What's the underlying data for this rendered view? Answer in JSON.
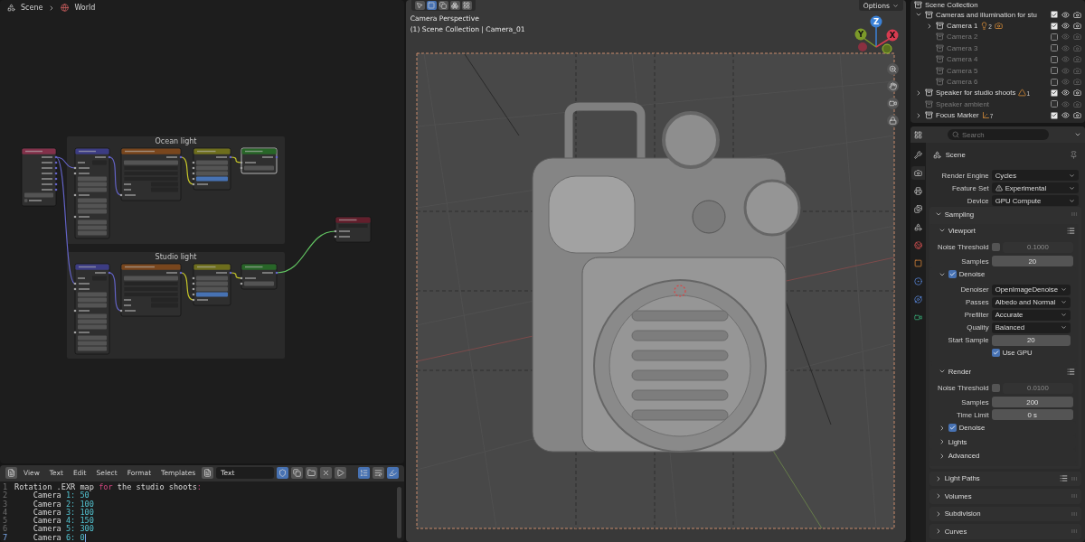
{
  "node_editor": {
    "breadcrumb": [
      "Scene",
      "World"
    ],
    "frames": [
      {
        "label": "Ocean light"
      },
      {
        "label": "Studio light"
      }
    ]
  },
  "text_editor": {
    "menus": [
      "View",
      "Text",
      "Edit",
      "Select",
      "Format",
      "Templates"
    ],
    "text_name": "Text",
    "fake_user": true,
    "toggles": [
      {
        "kind": "line_numbers",
        "on": true
      },
      {
        "kind": "word_wrap",
        "on": false
      },
      {
        "kind": "syntax",
        "on": true
      }
    ],
    "lines": [
      {
        "number": "1",
        "current": false,
        "segments": [
          {
            "kind": "plain",
            "text": "Rotation .EXR map "
          },
          {
            "kind": "keyword",
            "text": "for"
          },
          {
            "kind": "plain",
            "text": " the studio shoots"
          },
          {
            "kind": "keyword",
            "text": ":"
          }
        ]
      },
      {
        "number": "2",
        "current": false,
        "segments": [
          {
            "kind": "plain",
            "text": "    Camera "
          },
          {
            "kind": "number",
            "text": "1: 50"
          }
        ]
      },
      {
        "number": "3",
        "current": false,
        "segments": [
          {
            "kind": "plain",
            "text": "    Camera "
          },
          {
            "kind": "number",
            "text": "2: 100"
          }
        ]
      },
      {
        "number": "4",
        "current": false,
        "segments": [
          {
            "kind": "plain",
            "text": "    Camera "
          },
          {
            "kind": "number",
            "text": "3: 100"
          }
        ]
      },
      {
        "number": "5",
        "current": false,
        "segments": [
          {
            "kind": "plain",
            "text": "    Camera "
          },
          {
            "kind": "number",
            "text": "4: 150"
          }
        ]
      },
      {
        "number": "6",
        "current": false,
        "segments": [
          {
            "kind": "plain",
            "text": "    Camera "
          },
          {
            "kind": "number",
            "text": "5: 300"
          }
        ]
      },
      {
        "number": "7",
        "current": true,
        "segments": [
          {
            "kind": "plain",
            "text": "    Camera "
          },
          {
            "kind": "number",
            "text": "6: 0"
          }
        ]
      }
    ]
  },
  "viewport": {
    "options_label": "Options",
    "view_name": "Camera Perspective",
    "collection_info": "(1) Scene Collection | Camera_01",
    "axes": [
      "Z",
      "Y",
      "X"
    ]
  },
  "outliner": {
    "root": "Scene Collection",
    "items": [
      {
        "label": "Cameras and illumination for stu",
        "checked": true,
        "expanded": true,
        "children": [
          {
            "label": "Camera 1",
            "checked": true,
            "expanded": false,
            "badges": [
              {
                "kind": "light",
                "count": "2"
              },
              {
                "kind": "camera"
              }
            ]
          },
          {
            "label": "Camera 2",
            "checked": false
          },
          {
            "label": "Camera 3",
            "checked": false
          },
          {
            "label": "Camera 4",
            "checked": false
          },
          {
            "label": "Camera 5",
            "checked": false
          },
          {
            "label": "Camera 6",
            "checked": false
          }
        ]
      },
      {
        "label": "Speaker for studio shoots",
        "checked": true,
        "expanded": false,
        "badges": [
          {
            "kind": "speaker",
            "count": "1"
          }
        ]
      },
      {
        "label": "Speaker ambient",
        "checked": false
      },
      {
        "label": "Focus Marker",
        "checked": true,
        "expanded": false,
        "badges": [
          {
            "kind": "empty",
            "count": "7"
          }
        ]
      }
    ]
  },
  "properties": {
    "search_placeholder": "Search",
    "context": "Scene",
    "tabs": [
      {
        "kind": "tool",
        "selected": false
      },
      {
        "kind": "render",
        "selected": true
      },
      {
        "kind": "output",
        "selected": false
      },
      {
        "kind": "view_layer",
        "selected": false
      },
      {
        "kind": "scene",
        "selected": false
      },
      {
        "kind": "world",
        "selected": false
      },
      {
        "kind": "object",
        "selected": false
      },
      {
        "kind": "modifier",
        "selected": false
      },
      {
        "kind": "physics",
        "selected": false
      },
      {
        "kind": "data",
        "selected": false
      }
    ],
    "items": [
      {
        "kind": "dropdown",
        "label": "Render Engine",
        "value": "Cycles"
      },
      {
        "kind": "dropdown",
        "label": "Feature Set",
        "value": "Experimental",
        "warning": true
      },
      {
        "kind": "dropdown",
        "label": "Device",
        "value": "GPU Compute"
      },
      {
        "kind": "panel",
        "label": "Sampling",
        "expanded": true,
        "children": [
          {
            "kind": "subpanel",
            "label": "Viewport",
            "expanded": true,
            "presets": true,
            "children": [
              {
                "kind": "toggle_number",
                "label": "Noise Threshold",
                "checked": false,
                "value": "0.1000"
              },
              {
                "kind": "number",
                "label": "Samples",
                "value": "20"
              },
              {
                "kind": "subpanel",
                "label": "Denoise",
                "expanded": true,
                "checked": true,
                "children": [
                  {
                    "kind": "dropdown",
                    "label": "Denoiser",
                    "value": "OpenImageDenoise"
                  },
                  {
                    "kind": "dropdown",
                    "label": "Passes",
                    "value": "Albedo and Normal"
                  },
                  {
                    "kind": "dropdown",
                    "label": "Prefilter",
                    "value": "Accurate"
                  },
                  {
                    "kind": "dropdown",
                    "label": "Quality",
                    "value": "Balanced"
                  },
                  {
                    "kind": "number",
                    "label": "Start Sample",
                    "value": "20"
                  },
                  {
                    "kind": "checkbox",
                    "label": "Use GPU",
                    "checked": true
                  }
                ]
              }
            ]
          },
          {
            "kind": "subpanel",
            "label": "Render",
            "expanded": true,
            "presets": true,
            "children": [
              {
                "kind": "toggle_number",
                "label": "Noise Threshold",
                "checked": false,
                "value": "0.0100"
              },
              {
                "kind": "number",
                "label": "Samples",
                "value": "200"
              },
              {
                "kind": "number",
                "label": "Time Limit",
                "value": "0 s"
              },
              {
                "kind": "subpanel",
                "label": "Denoise",
                "expanded": false,
                "checked": true
              },
              {
                "kind": "subpanel",
                "label": "Lights",
                "expanded": false
              },
              {
                "kind": "subpanel",
                "label": "Advanced",
                "expanded": false
              }
            ]
          }
        ]
      },
      {
        "kind": "panel",
        "label": "Light Paths",
        "expanded": false,
        "presets": true
      },
      {
        "kind": "panel",
        "label": "Volumes",
        "expanded": false
      },
      {
        "kind": "panel",
        "label": "Subdivision",
        "expanded": false
      },
      {
        "kind": "panel",
        "label": "Curves",
        "expanded": false
      }
    ]
  }
}
